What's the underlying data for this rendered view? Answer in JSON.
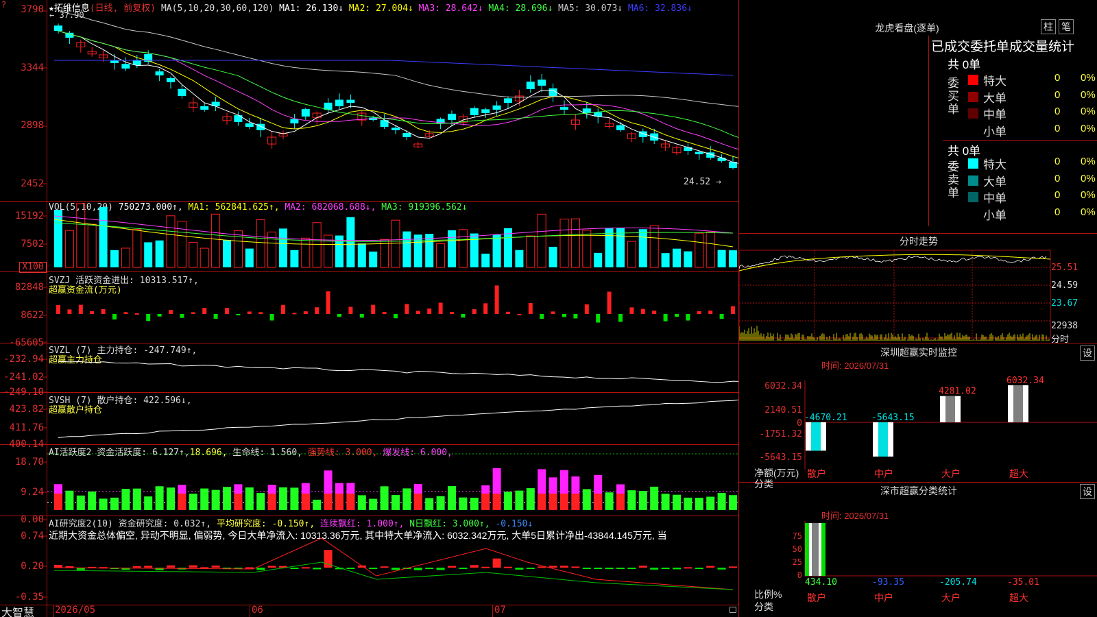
{
  "app": {
    "name": "大智慧",
    "lock_icon": "lock-icon"
  },
  "colors": {
    "up": "#ff2020",
    "down": "#00ffff",
    "frame": "#b01010",
    "axis_text": "#e03030"
  },
  "kline": {
    "title": "★拓维信息",
    "period": "(日线, 前复权)",
    "ma_header": "MA(5,10,20,30,60,120)",
    "ma": [
      {
        "label": "MA1: 26.130↓",
        "color": "#ffffff"
      },
      {
        "label": "MA2: 27.004↓",
        "color": "#ffff00"
      },
      {
        "label": "MA3: 28.642↓",
        "color": "#ff40ff"
      },
      {
        "label": "MA4: 28.696↓",
        "color": "#40ff40"
      },
      {
        "label": "MA5: 30.073↓",
        "color": "#c8c8c8"
      },
      {
        "label": "MA6: 32.836↓",
        "color": "#3c3cff"
      }
    ],
    "y_labels": [
      "3790",
      "3344",
      "2898",
      "2452"
    ],
    "high_note": "← 37.90",
    "low_note": "24.52 →"
  },
  "vol": {
    "header": "VOL(5,10,20)",
    "value": "750273.000↑,",
    "ma1": "MA1: 562841.625↑,",
    "ma2": "MA2: 682068.688↓,",
    "ma3": "MA3: 919396.562↓",
    "y_labels": [
      "15192",
      "7502"
    ],
    "unit": "X100"
  },
  "svzj": {
    "header": "SVZJ  活跃资金进出: 10313.517↑,",
    "sub": "超赢资金流(万元)",
    "y_labels": [
      "82848",
      "8622",
      "-65605"
    ]
  },
  "svzl": {
    "header": "SVZL (7) 主力持仓: -247.749↑,",
    "sub": "超赢主力持仓",
    "y_labels": [
      "-232.94",
      "-241.02",
      "-249.10"
    ]
  },
  "svsh": {
    "header": "SVSH (7) 散户持仓: 422.596↓,",
    "sub": "超赢散户持仓",
    "y_labels": [
      "423.82",
      "411.76",
      "400.14"
    ]
  },
  "ai_active": {
    "header_a": "AI活跃度2 资金活跃度: 6.127↑,",
    "header_b": "18.696,",
    "header_c": "生命线: 1.560,",
    "header_d": "强势线: 3.000,",
    "header_e": "爆发线: 6.000,",
    "y_labels": [
      "18.70",
      "9.24",
      "0.00"
    ]
  },
  "ai_research": {
    "header_a": "AI研究度2(10) 资金研究度: 0.032↑,",
    "header_b": "平均研究度: -0.150↑,",
    "header_c": "连续飘红: 1.000↑,",
    "header_d": "N日飘红: 3.000↑,",
    "header_e": "-0.150↓",
    "comment": "近期大资金总体偏空, 异动不明显, 偏弱势, 今日大单净流入: 10313.36万元, 其中特大单净流入: 6032.342万元, 大单5日累计净出-43844.145万元, 当",
    "y_labels": [
      "0.74",
      "0.20",
      "-0.35"
    ]
  },
  "x_axis": [
    "2026/05",
    "06",
    "07"
  ],
  "longhu": {
    "title": "龙虎看盘(逐单)",
    "btn_a": "柱",
    "btn_b": "笔",
    "stat_title": "已成交委托单成交量统计",
    "buy": {
      "label": "委买单",
      "total": "共 0单",
      "rows": [
        {
          "name": "特大",
          "count": "0",
          "pct": "0%",
          "color": "#ff0000"
        },
        {
          "name": "大单",
          "count": "0",
          "pct": "0%",
          "color": "#900000"
        },
        {
          "name": "中单",
          "count": "0",
          "pct": "0%",
          "color": "#600000"
        },
        {
          "name": "小单",
          "count": "0",
          "pct": "0%",
          "color": "#000000"
        }
      ]
    },
    "sell": {
      "label": "委卖单",
      "total": "共 0单",
      "rows": [
        {
          "name": "特大",
          "count": "0",
          "pct": "0%",
          "color": "#00ffff"
        },
        {
          "name": "大单",
          "count": "0",
          "pct": "0%",
          "color": "#008c8c"
        },
        {
          "name": "中单",
          "count": "0",
          "pct": "0%",
          "color": "#006464"
        },
        {
          "name": "小单",
          "count": "0",
          "pct": "0%",
          "color": "#000000"
        }
      ]
    }
  },
  "fenshi": {
    "title": "分时走势",
    "prices": [
      "25.51",
      "24.59",
      "23.67"
    ],
    "vol_label": "22938",
    "bottom_label": "分时"
  },
  "sz_monitor": {
    "title": "深圳超赢实时监控",
    "settings": "设",
    "time": "时间: 2026/07/31",
    "y_labels": [
      "6032.34",
      "2140.51",
      "0",
      "-1751.32",
      "-5643.15"
    ],
    "ylabel": "净额(万元)",
    "xlabel": "分类",
    "categories": [
      "散户",
      "中户",
      "大户",
      "超大"
    ],
    "values": [
      -4670.21,
      -5643.15,
      4281.02,
      6032.34
    ],
    "value_labels": [
      "-4670.21",
      "-5643.15",
      "4281.02",
      "6032.34"
    ]
  },
  "sz_class": {
    "title": "深市超赢分类统计",
    "settings": "设",
    "time": "时间: 2026/07/31",
    "y_labels": [
      "75",
      "50",
      "25",
      "0"
    ],
    "ylabel": "比例%",
    "xlabel": "分类",
    "categories": [
      "散户",
      "中户",
      "大户",
      "超大"
    ],
    "value_labels": [
      "434.10",
      "-93.35",
      "-205.74",
      "-35.01"
    ]
  }
}
